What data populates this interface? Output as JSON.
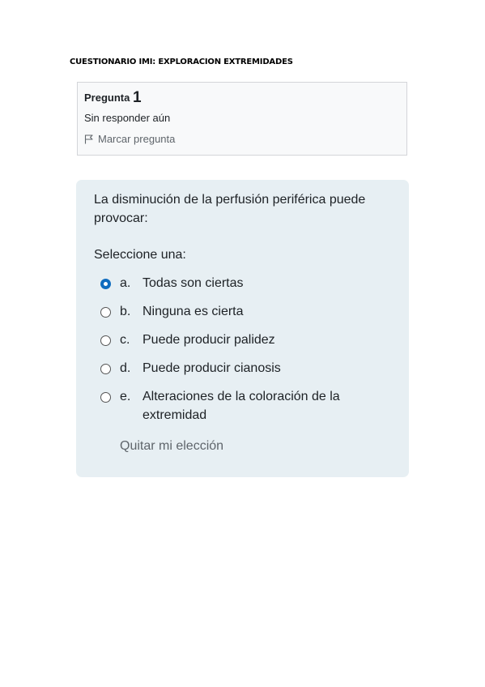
{
  "document": {
    "title": "CUESTIONARIO IMI: EXPLORACION EXTREMIDADES"
  },
  "question_info": {
    "label": "Pregunta",
    "number": "1",
    "state": "Sin responder aún",
    "flag_label": "Marcar pregunta"
  },
  "question": {
    "text": "La disminución de la perfusión periférica puede provocar:",
    "prompt": "Seleccione una:",
    "options": [
      {
        "letter": "a.",
        "text": "Todas son ciertas",
        "selected": true
      },
      {
        "letter": "b.",
        "text": "Ninguna es cierta",
        "selected": false
      },
      {
        "letter": "c.",
        "text": "Puede producir palidez",
        "selected": false
      },
      {
        "letter": "d.",
        "text": "Puede producir cianosis",
        "selected": false
      },
      {
        "letter": "e.",
        "text": "Alteraciones de la coloración de la extremidad",
        "selected": false
      }
    ],
    "clear_label": "Quitar mi elección"
  },
  "colors": {
    "accent": "#0f6cbf",
    "question_bg": "#e7eff3",
    "info_bg": "#f8f9fa"
  }
}
